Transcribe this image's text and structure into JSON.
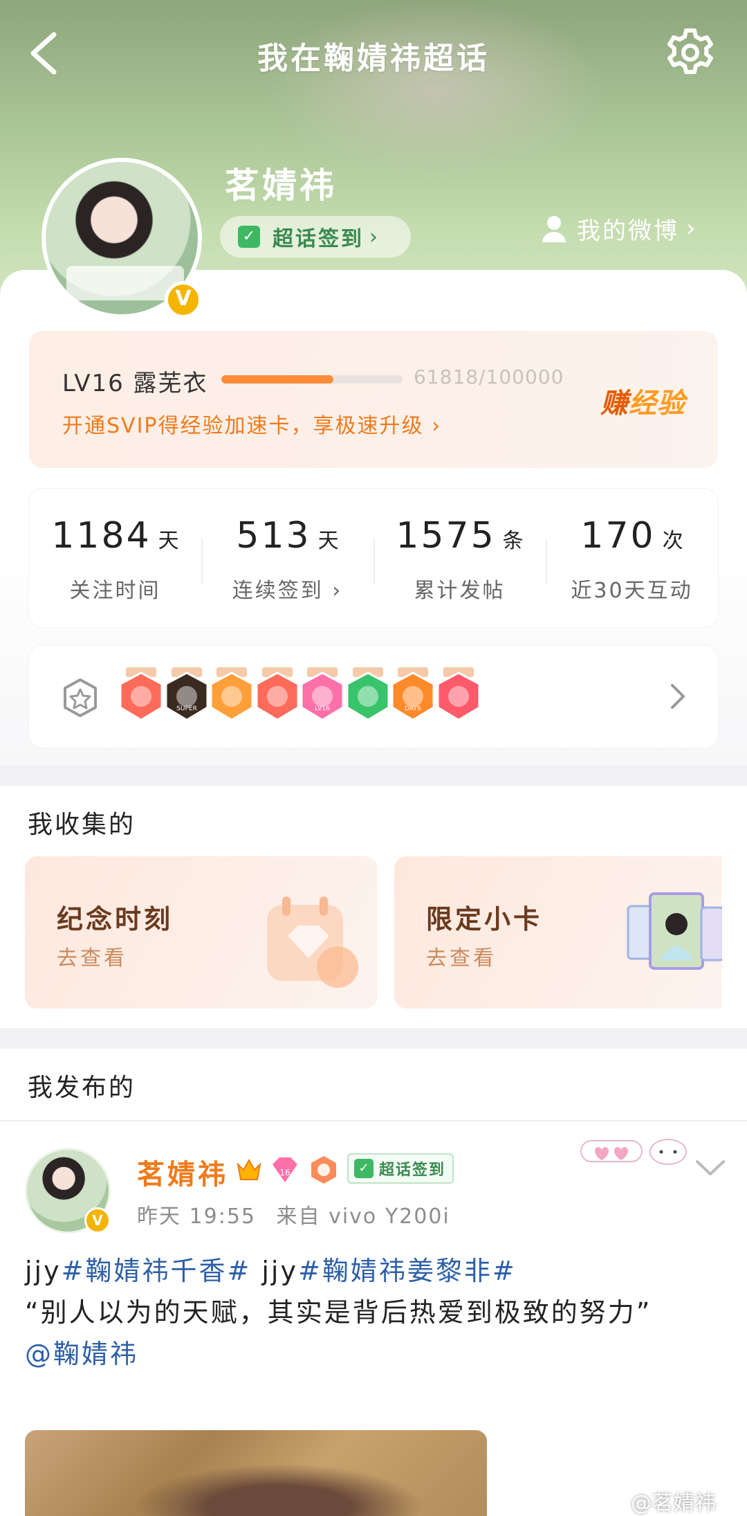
{
  "header": {
    "title": "我在鞠婧祎超话"
  },
  "profile": {
    "username": "茗婧祎",
    "verified_mark": "V",
    "checkin_label": "超话签到",
    "my_weibo_label": "我的微博"
  },
  "level": {
    "label": "LV16 露芜衣",
    "progress_text": "61818/100000",
    "progress_fraction": 0.618,
    "promo": "开通SVIP得经验加速卡，享极速升级",
    "earn_a": "赚",
    "earn_b": "经验"
  },
  "stats": [
    {
      "value": "1184",
      "unit": "天",
      "label": "关注时间"
    },
    {
      "value": "513",
      "unit": "天",
      "label": "连续签到"
    },
    {
      "value": "1575",
      "unit": "条",
      "label": "累计发帖"
    },
    {
      "value": "170",
      "unit": "次",
      "label": "近30天互动"
    }
  ],
  "badges": {
    "items": [
      {
        "icon": "cat-badge-icon",
        "color": "#ff6b5a"
      },
      {
        "icon": "super-crown-badge-icon",
        "color": "#3a2a20",
        "text": "SUPER"
      },
      {
        "icon": "crown-badge-icon",
        "color": "#ff9f3a"
      },
      {
        "icon": "smile-badge-icon",
        "color": "#ff6b5a"
      },
      {
        "icon": "lv16-badge-icon",
        "color": "#ff6fa8",
        "text": "LV16"
      },
      {
        "icon": "hands-badge-icon",
        "color": "#39c46b"
      },
      {
        "icon": "days100-badge-icon",
        "color": "#ff8a2a",
        "text": "DAYS"
      },
      {
        "icon": "trophy-badge-icon",
        "color": "#ff5a6a"
      }
    ]
  },
  "collect": {
    "title": "我收集的",
    "cards": [
      {
        "title": "纪念时刻",
        "sub": "去查看"
      },
      {
        "title": "限定小卡",
        "sub": "去查看"
      }
    ]
  },
  "posts": {
    "title": "我发布的",
    "post": {
      "author": "茗婧祎",
      "time": "昨天 19:55",
      "source": "来自 vivo Y200i",
      "checkin_label": "超话签到",
      "prefix1": "jjy",
      "tag1": "#鞠婧祎千香#",
      "prefix2": " jjy",
      "tag2": "#鞠婧祎姜黎非#",
      "quote": "“别人以为的天赋，其实是背后热爱到极致的努力”",
      "mention": "@鞠婧祎"
    }
  },
  "watermark": "@茗婧祎",
  "colors": {
    "accent_orange": "#f07a1a",
    "checkin_green": "#3fb864",
    "link_blue": "#2d5fa8"
  }
}
